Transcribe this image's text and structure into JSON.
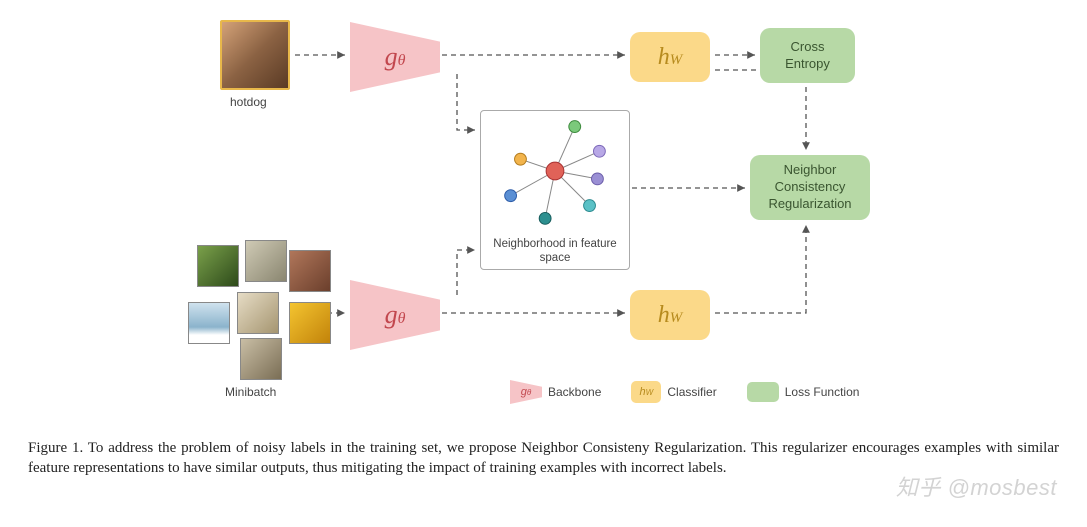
{
  "diagram": {
    "single_image_label": "hotdog",
    "minibatch_label": "Minibatch",
    "backbone_symbol_g": "g",
    "backbone_symbol_theta": "θ",
    "classifier_symbol_h": "h",
    "classifier_symbol_W": "W",
    "loss_cross_entropy": "Cross\nEntropy",
    "loss_ncr": "Neighbor\nConsistency\nRegularization",
    "neighborhood_caption": "Neighborhood in feature space"
  },
  "legend": {
    "backbone": "Backbone",
    "classifier": "Classifier",
    "loss": "Loss Function"
  },
  "caption": "Figure 1.  To address the problem of noisy labels in the training set, we propose Neighbor Consisteny Regularization.  This regularizer encourages examples with similar feature representations to have similar outputs, thus mitigating the impact of training examples with incorrect labels.",
  "watermark": "知乎 @mosbest"
}
